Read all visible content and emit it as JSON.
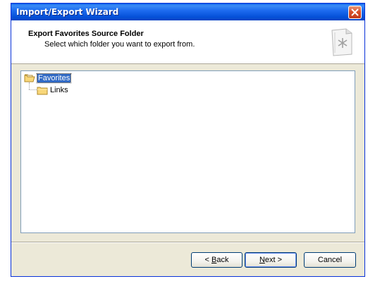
{
  "window": {
    "title": "Import/Export Wizard"
  },
  "header": {
    "title": "Export Favorites Source Folder",
    "subtitle": "Select which folder you want to export from.",
    "icon": "wizard-document-icon"
  },
  "tree": {
    "items": [
      {
        "label": "Favorites",
        "icon": "folder-open-icon",
        "selected": true
      },
      {
        "label": "Links",
        "icon": "folder-icon",
        "selected": false
      }
    ]
  },
  "buttons": {
    "back": {
      "prefix": "< ",
      "accel": "B",
      "rest": "ack"
    },
    "next": {
      "accel": "N",
      "rest": "ext",
      "suffix": " >"
    },
    "cancel": "Cancel"
  },
  "colors": {
    "title_bar": "#0a5ee9",
    "selection": "#316ac5",
    "dialog_bg": "#ece9d8"
  }
}
